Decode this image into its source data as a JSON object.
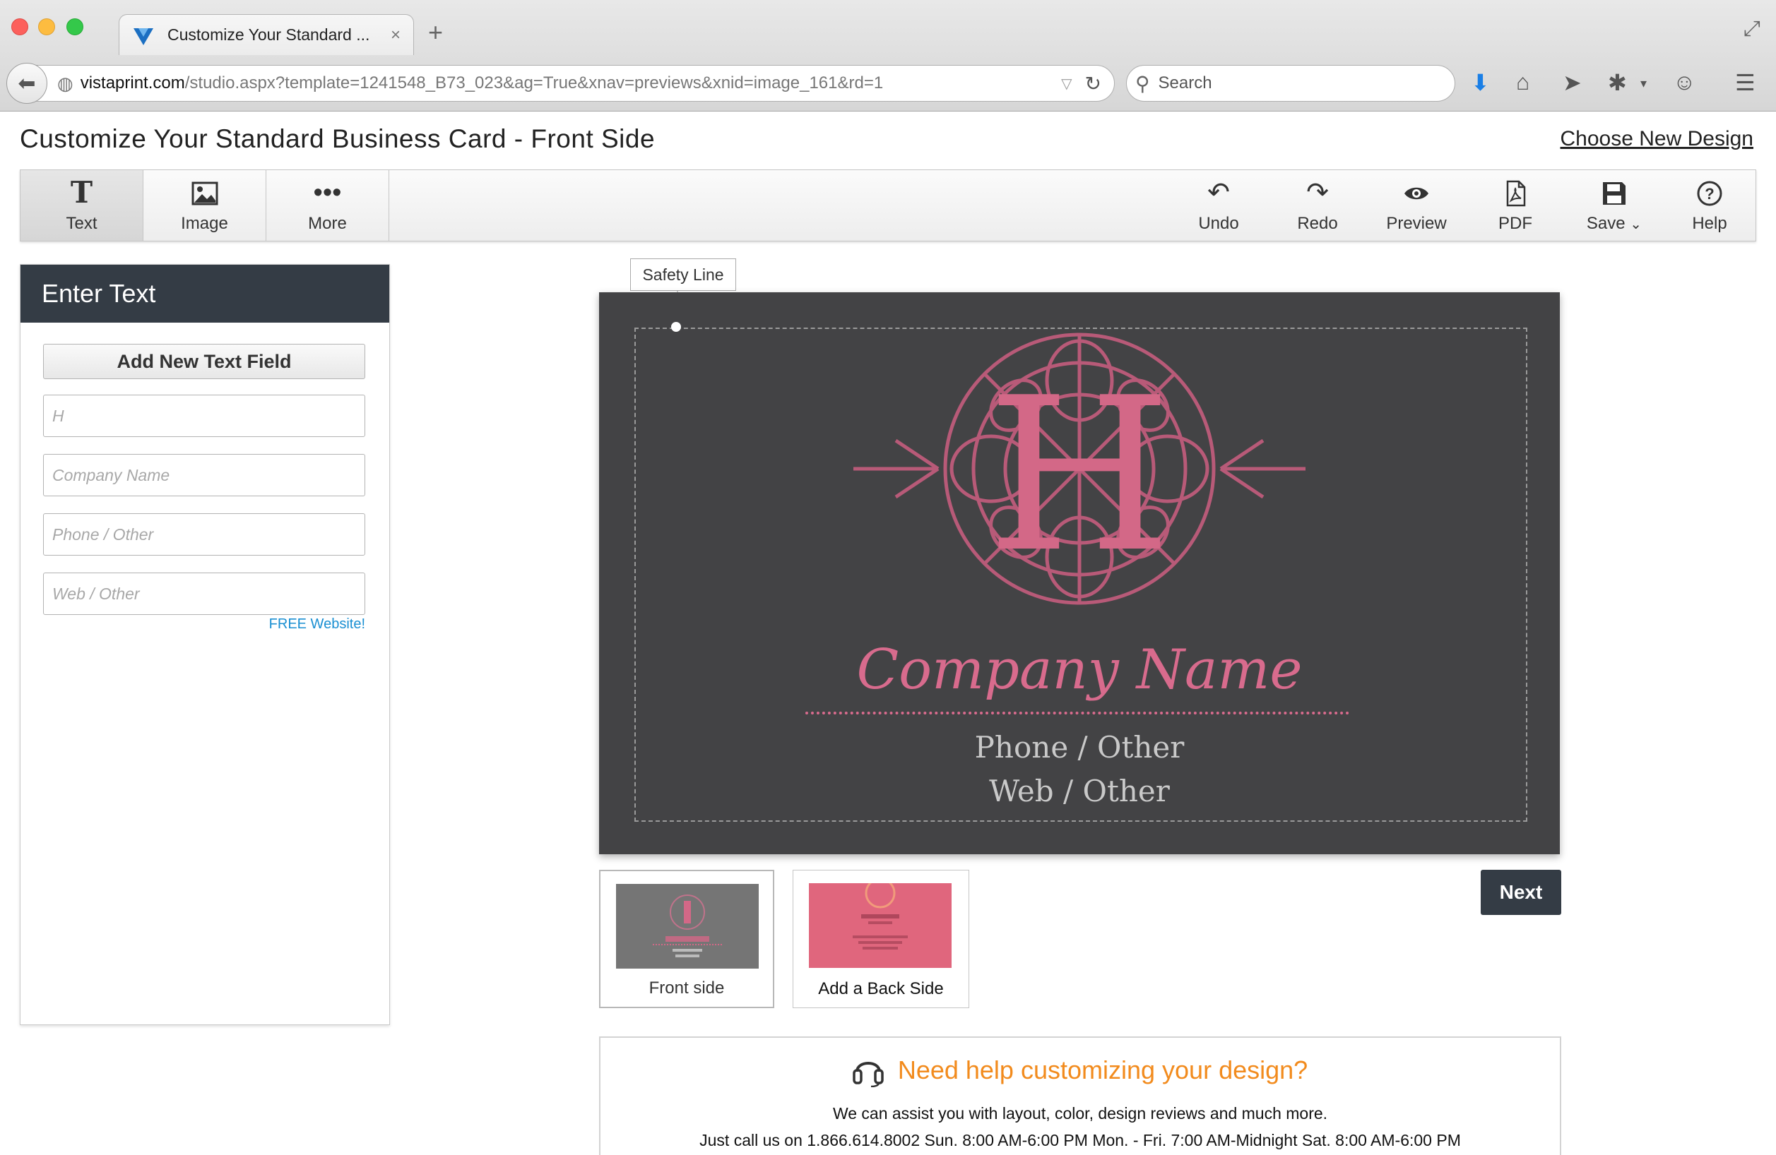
{
  "browser": {
    "tab_title": "Customize Your Standard ...",
    "tab_close": "×",
    "new_tab": "+",
    "url_host": "vistaprint.com",
    "url_path": "/studio.aspx?template=1241548_B73_023&ag=True&xnav=previews&xnid=image_161&rd=1",
    "search_placeholder": "Search"
  },
  "page": {
    "title": "Customize Your Standard Business Card - Front Side",
    "choose_new_design": "Choose New Design"
  },
  "toolbar": {
    "left": [
      {
        "label": "Text",
        "icon": "text-icon"
      },
      {
        "label": "Image",
        "icon": "image-icon"
      },
      {
        "label": "More",
        "icon": "more-icon"
      }
    ],
    "right": [
      {
        "label": "Undo",
        "icon": "undo-icon"
      },
      {
        "label": "Redo",
        "icon": "redo-icon"
      },
      {
        "label": "Preview",
        "icon": "eye-icon"
      },
      {
        "label": "PDF",
        "icon": "pdf-icon"
      },
      {
        "label": "Save",
        "icon": "save-icon"
      },
      {
        "label": "Help",
        "icon": "help-icon"
      }
    ]
  },
  "text_panel": {
    "header": "Enter Text",
    "add_button": "Add New Text Field",
    "fields": [
      {
        "value": "",
        "placeholder": "H"
      },
      {
        "value": "",
        "placeholder": "Company Name"
      },
      {
        "value": "",
        "placeholder": "Phone / Other"
      },
      {
        "value": "",
        "placeholder": "Web / Other"
      }
    ],
    "free_website": "FREE Website!"
  },
  "canvas": {
    "safety_line_label": "Safety Line",
    "monogram": "H",
    "company": "Company Name",
    "phone": "Phone / Other",
    "web": "Web / Other",
    "colors": {
      "card_bg": "#434345",
      "accent_pink": "#d86b8d",
      "subtext": "#c9c9c9"
    }
  },
  "thumbnails": [
    {
      "label": "Front side"
    },
    {
      "label": "Add a Back Side"
    }
  ],
  "next_button": "Next",
  "help": {
    "title": "Need help customizing your design?",
    "line1": "We can assist you with layout, color, design reviews and much more.",
    "line2": "Just call us on 1.866.614.8002 Sun. 8:00 AM-6:00 PM Mon. - Fri. 7:00 AM-Midnight Sat. 8:00 AM-6:00 PM"
  }
}
